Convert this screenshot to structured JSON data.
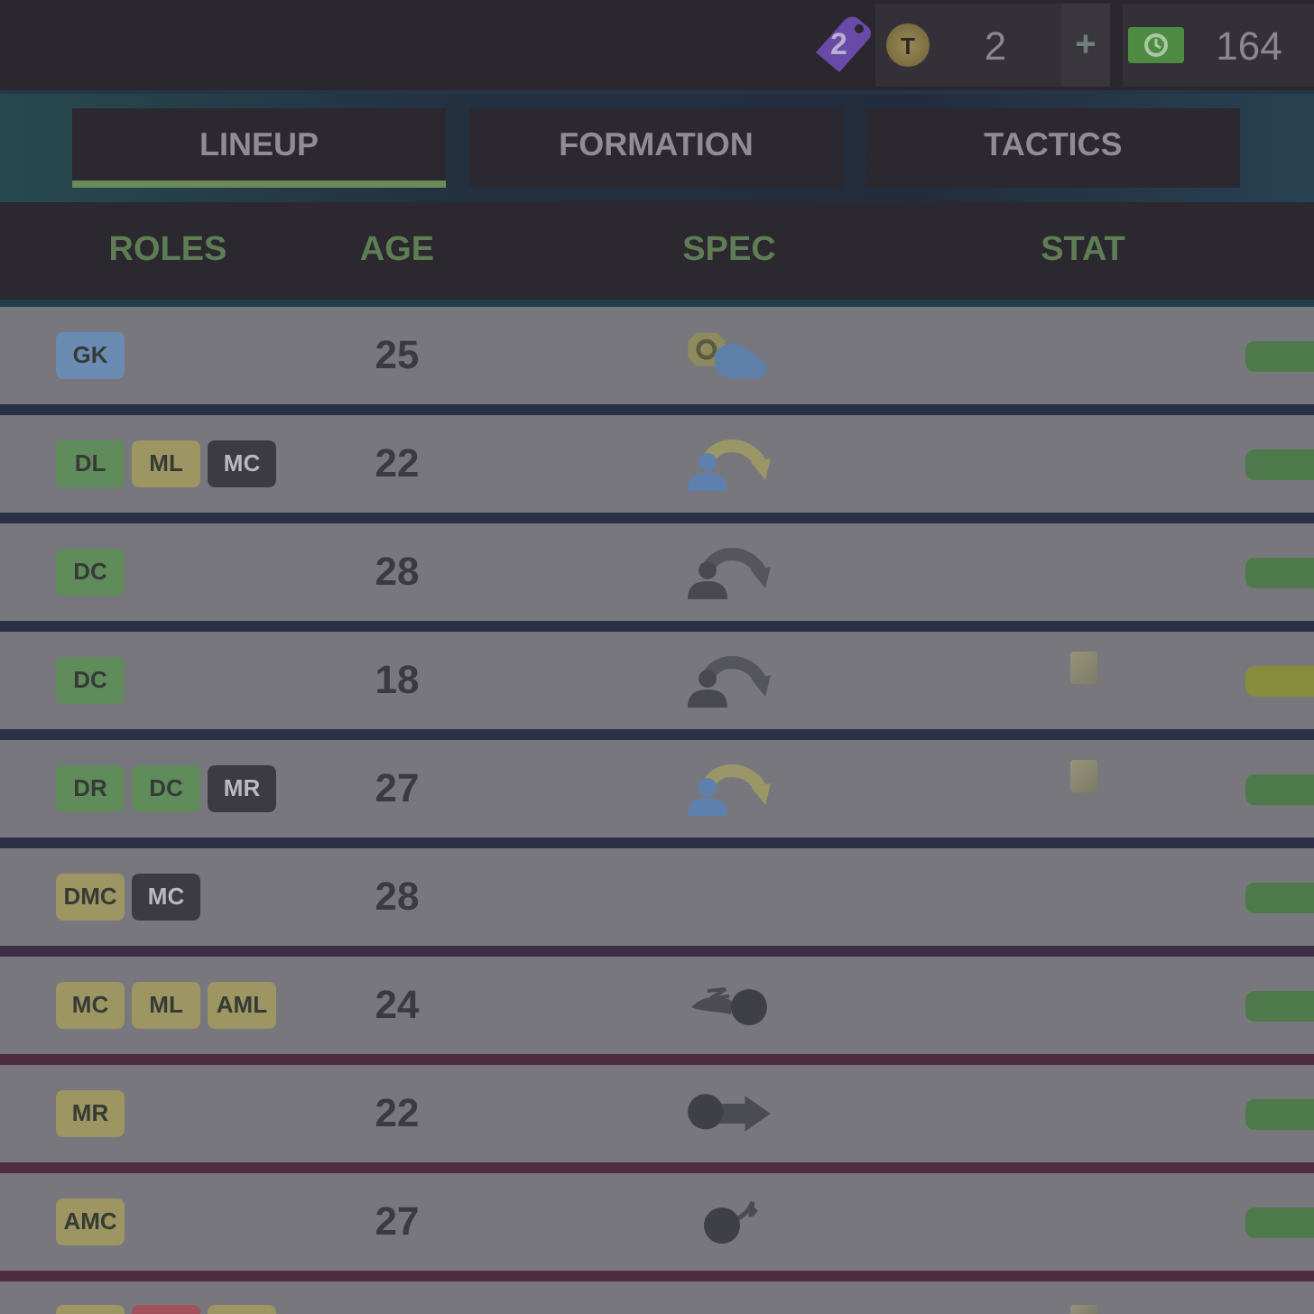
{
  "top_bar": {
    "badge_count": "2",
    "coins": {
      "symbol": "T",
      "amount": "2",
      "add": "+"
    },
    "cash": {
      "amount": "164"
    }
  },
  "tabs": [
    {
      "label": "LINEUP",
      "selected": true
    },
    {
      "label": "FORMATION",
      "selected": false
    },
    {
      "label": "TACTICS",
      "selected": false
    }
  ],
  "table": {
    "columns": [
      "ROLES",
      "AGE",
      "SPEC",
      "STAT"
    ],
    "rows": [
      {
        "roles": [
          {
            "label": "GK",
            "color": "#6a8cb2"
          }
        ],
        "age": "25",
        "spec": {
          "kind": "glove"
        },
        "card": false,
        "bar": {
          "color": "#4e7a4b"
        },
        "cut_off": false
      },
      {
        "roles": [
          {
            "label": "DL",
            "color": "#5f8c5a"
          },
          {
            "label": "ML",
            "color": "#9d9562"
          },
          {
            "label": "MC",
            "color": "#3c3b44"
          }
        ],
        "age": "22",
        "spec": {
          "kind": "person",
          "tinted": true
        },
        "card": false,
        "bar": {
          "color": "#4e7a4b"
        },
        "cut_off": false
      },
      {
        "roles": [
          {
            "label": "DC",
            "color": "#5f8c5a"
          }
        ],
        "age": "28",
        "spec": {
          "kind": "person",
          "tinted": false
        },
        "card": false,
        "bar": {
          "color": "#4e7a4b"
        },
        "cut_off": false
      },
      {
        "roles": [
          {
            "label": "DC",
            "color": "#5f8c5a"
          }
        ],
        "age": "18",
        "spec": {
          "kind": "person",
          "tinted": false
        },
        "card": true,
        "bar": {
          "color": "#878c3c"
        },
        "cut_off": false
      },
      {
        "roles": [
          {
            "label": "DR",
            "color": "#5f8c5a"
          },
          {
            "label": "DC",
            "color": "#5f8c5a"
          },
          {
            "label": "MR",
            "color": "#3c3b44"
          }
        ],
        "age": "27",
        "spec": {
          "kind": "person",
          "tinted": true
        },
        "card": true,
        "bar": {
          "color": "#4e7a4b"
        },
        "cut_off": false
      },
      {
        "roles": [
          {
            "label": "DMC",
            "color": "#9d9562"
          },
          {
            "label": "MC",
            "color": "#3c3b44"
          }
        ],
        "age": "28",
        "card": false,
        "bar": {
          "color": "#4e7a4b"
        },
        "cut_off": false
      },
      {
        "roles": [
          {
            "label": "MC",
            "color": "#9d9562"
          },
          {
            "label": "ML",
            "color": "#9d9562"
          },
          {
            "label": "AML",
            "color": "#9d9562"
          }
        ],
        "age": "24",
        "spec": {
          "kind": "swirl"
        },
        "card": false,
        "bar": {
          "color": "#4e7a4b"
        },
        "cut_off": false
      },
      {
        "roles": [
          {
            "label": "MR",
            "color": "#9d9562"
          }
        ],
        "age": "22",
        "spec": {
          "kind": "dash"
        },
        "card": false,
        "bar": {
          "color": "#4e7a4b"
        },
        "cut_off": false
      },
      {
        "roles": [
          {
            "label": "AMC",
            "color": "#9d9562"
          }
        ],
        "age": "27",
        "spec": {
          "kind": "spark"
        },
        "card": false,
        "bar": {
          "color": "#4e7a4b"
        },
        "cut_off": false
      },
      {
        "roles": [
          {
            "color": "#9d9562"
          },
          {
            "color": "#a2505a"
          },
          {
            "color": "#9d9562"
          }
        ],
        "card": true,
        "cut_off": true
      }
    ]
  }
}
